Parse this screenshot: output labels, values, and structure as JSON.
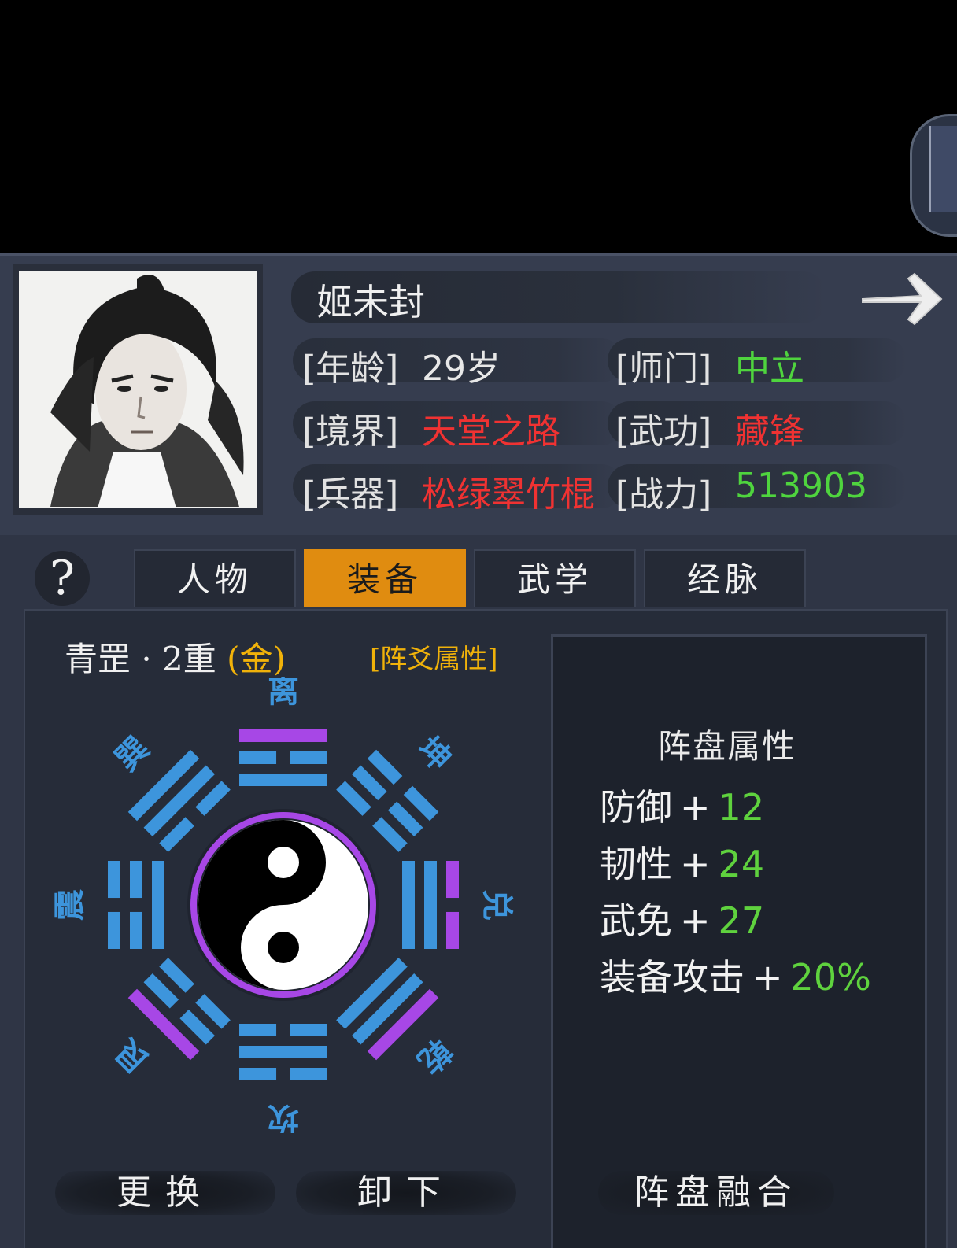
{
  "character": {
    "name": "姬未封",
    "fields": [
      {
        "label": "[年龄]",
        "value": "29岁",
        "color": "#e8e8e8"
      },
      {
        "label": "[师门]",
        "value": "中立",
        "color": "#4fd43e"
      },
      {
        "label": "[境界]",
        "value": "天堂之路",
        "color": "#f03232"
      },
      {
        "label": "[武功]",
        "value": "藏锋",
        "color": "#f03232"
      },
      {
        "label": "[兵器]",
        "value": "松绿翠竹棍",
        "color": "#f03232"
      },
      {
        "label": "[战力]",
        "value": "513903",
        "color": "#4fd43e"
      }
    ]
  },
  "help": "?",
  "tabs": [
    {
      "label": "人物",
      "active": false
    },
    {
      "label": "装备",
      "active": true
    },
    {
      "label": "武学",
      "active": false
    },
    {
      "label": "经脉",
      "active": false
    }
  ],
  "formation": {
    "name": "青罡 · 2重 ",
    "element": "(金)",
    "attr_link": "[阵爻属性]"
  },
  "trigrams": {
    "south": "离",
    "southwest": "坤",
    "west": "兑",
    "northwest": "乾",
    "north": "坎",
    "northeast": "艮",
    "east": "震",
    "southeast": "巽"
  },
  "panel": {
    "title": "阵盘属性",
    "stats": [
      {
        "name": "防御",
        "plus": "+",
        "value": "12"
      },
      {
        "name": "韧性",
        "plus": "+",
        "value": "24"
      },
      {
        "name": "武免",
        "plus": "+",
        "value": "27"
      },
      {
        "name": "装备攻击",
        "plus": "+",
        "value": "20%"
      }
    ]
  },
  "buttons": {
    "replace": "更换",
    "unload": "卸下",
    "fusion": "阵盘融合"
  },
  "colors": {
    "trigram_blue": "#3d95dc",
    "trigram_purple": "#a747e6",
    "tab_active": "#e08c10",
    "accent_gold": "#f0b20a"
  }
}
